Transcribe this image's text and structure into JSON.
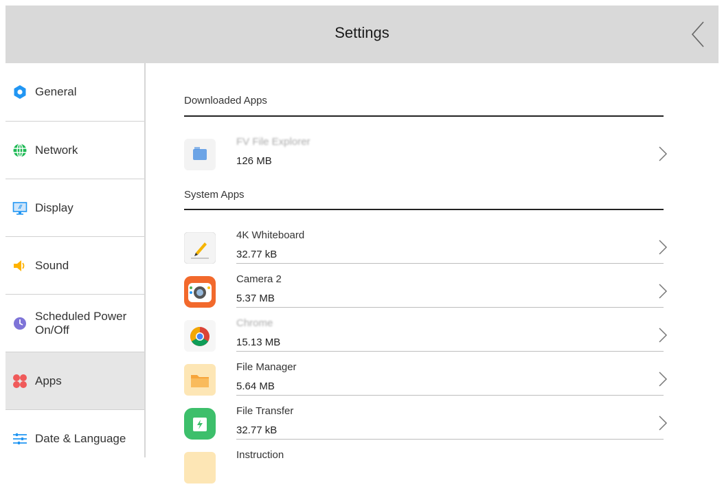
{
  "header": {
    "title": "Settings"
  },
  "sidebar": {
    "items": [
      {
        "label": "General",
        "icon": "gear-icon"
      },
      {
        "label": "Network",
        "icon": "globe-icon"
      },
      {
        "label": "Display",
        "icon": "monitor-icon"
      },
      {
        "label": "Sound",
        "icon": "speaker-icon"
      },
      {
        "label": "Scheduled Power On/Off",
        "icon": "clock-icon"
      },
      {
        "label": "Apps",
        "icon": "apps-icon",
        "active": true
      },
      {
        "label": "Date & Language",
        "icon": "sliders-icon"
      }
    ]
  },
  "main": {
    "downloaded_title": "Downloaded Apps",
    "system_title": "System Apps",
    "downloaded_apps": [
      {
        "name": "FV File Explorer",
        "size": "126 MB",
        "icon": "file-explorer-icon"
      }
    ],
    "system_apps": [
      {
        "name": "4K Whiteboard",
        "size": "32.77 kB",
        "icon": "whiteboard-icon"
      },
      {
        "name": "Camera 2",
        "size": "5.37 MB",
        "icon": "camera-icon"
      },
      {
        "name": "Chrome",
        "size": "15.13 MB",
        "icon": "chrome-icon"
      },
      {
        "name": "File Manager",
        "size": "5.64 MB",
        "icon": "folder-icon"
      },
      {
        "name": "File Transfer",
        "size": "32.77 kB",
        "icon": "file-transfer-icon"
      },
      {
        "name": "Instruction",
        "size": "",
        "icon": "instruction-icon"
      }
    ]
  },
  "colors": {
    "header_bg": "#d9d9d9",
    "accent_blue": "#2196f3",
    "active_bg": "#e6e6e6"
  }
}
